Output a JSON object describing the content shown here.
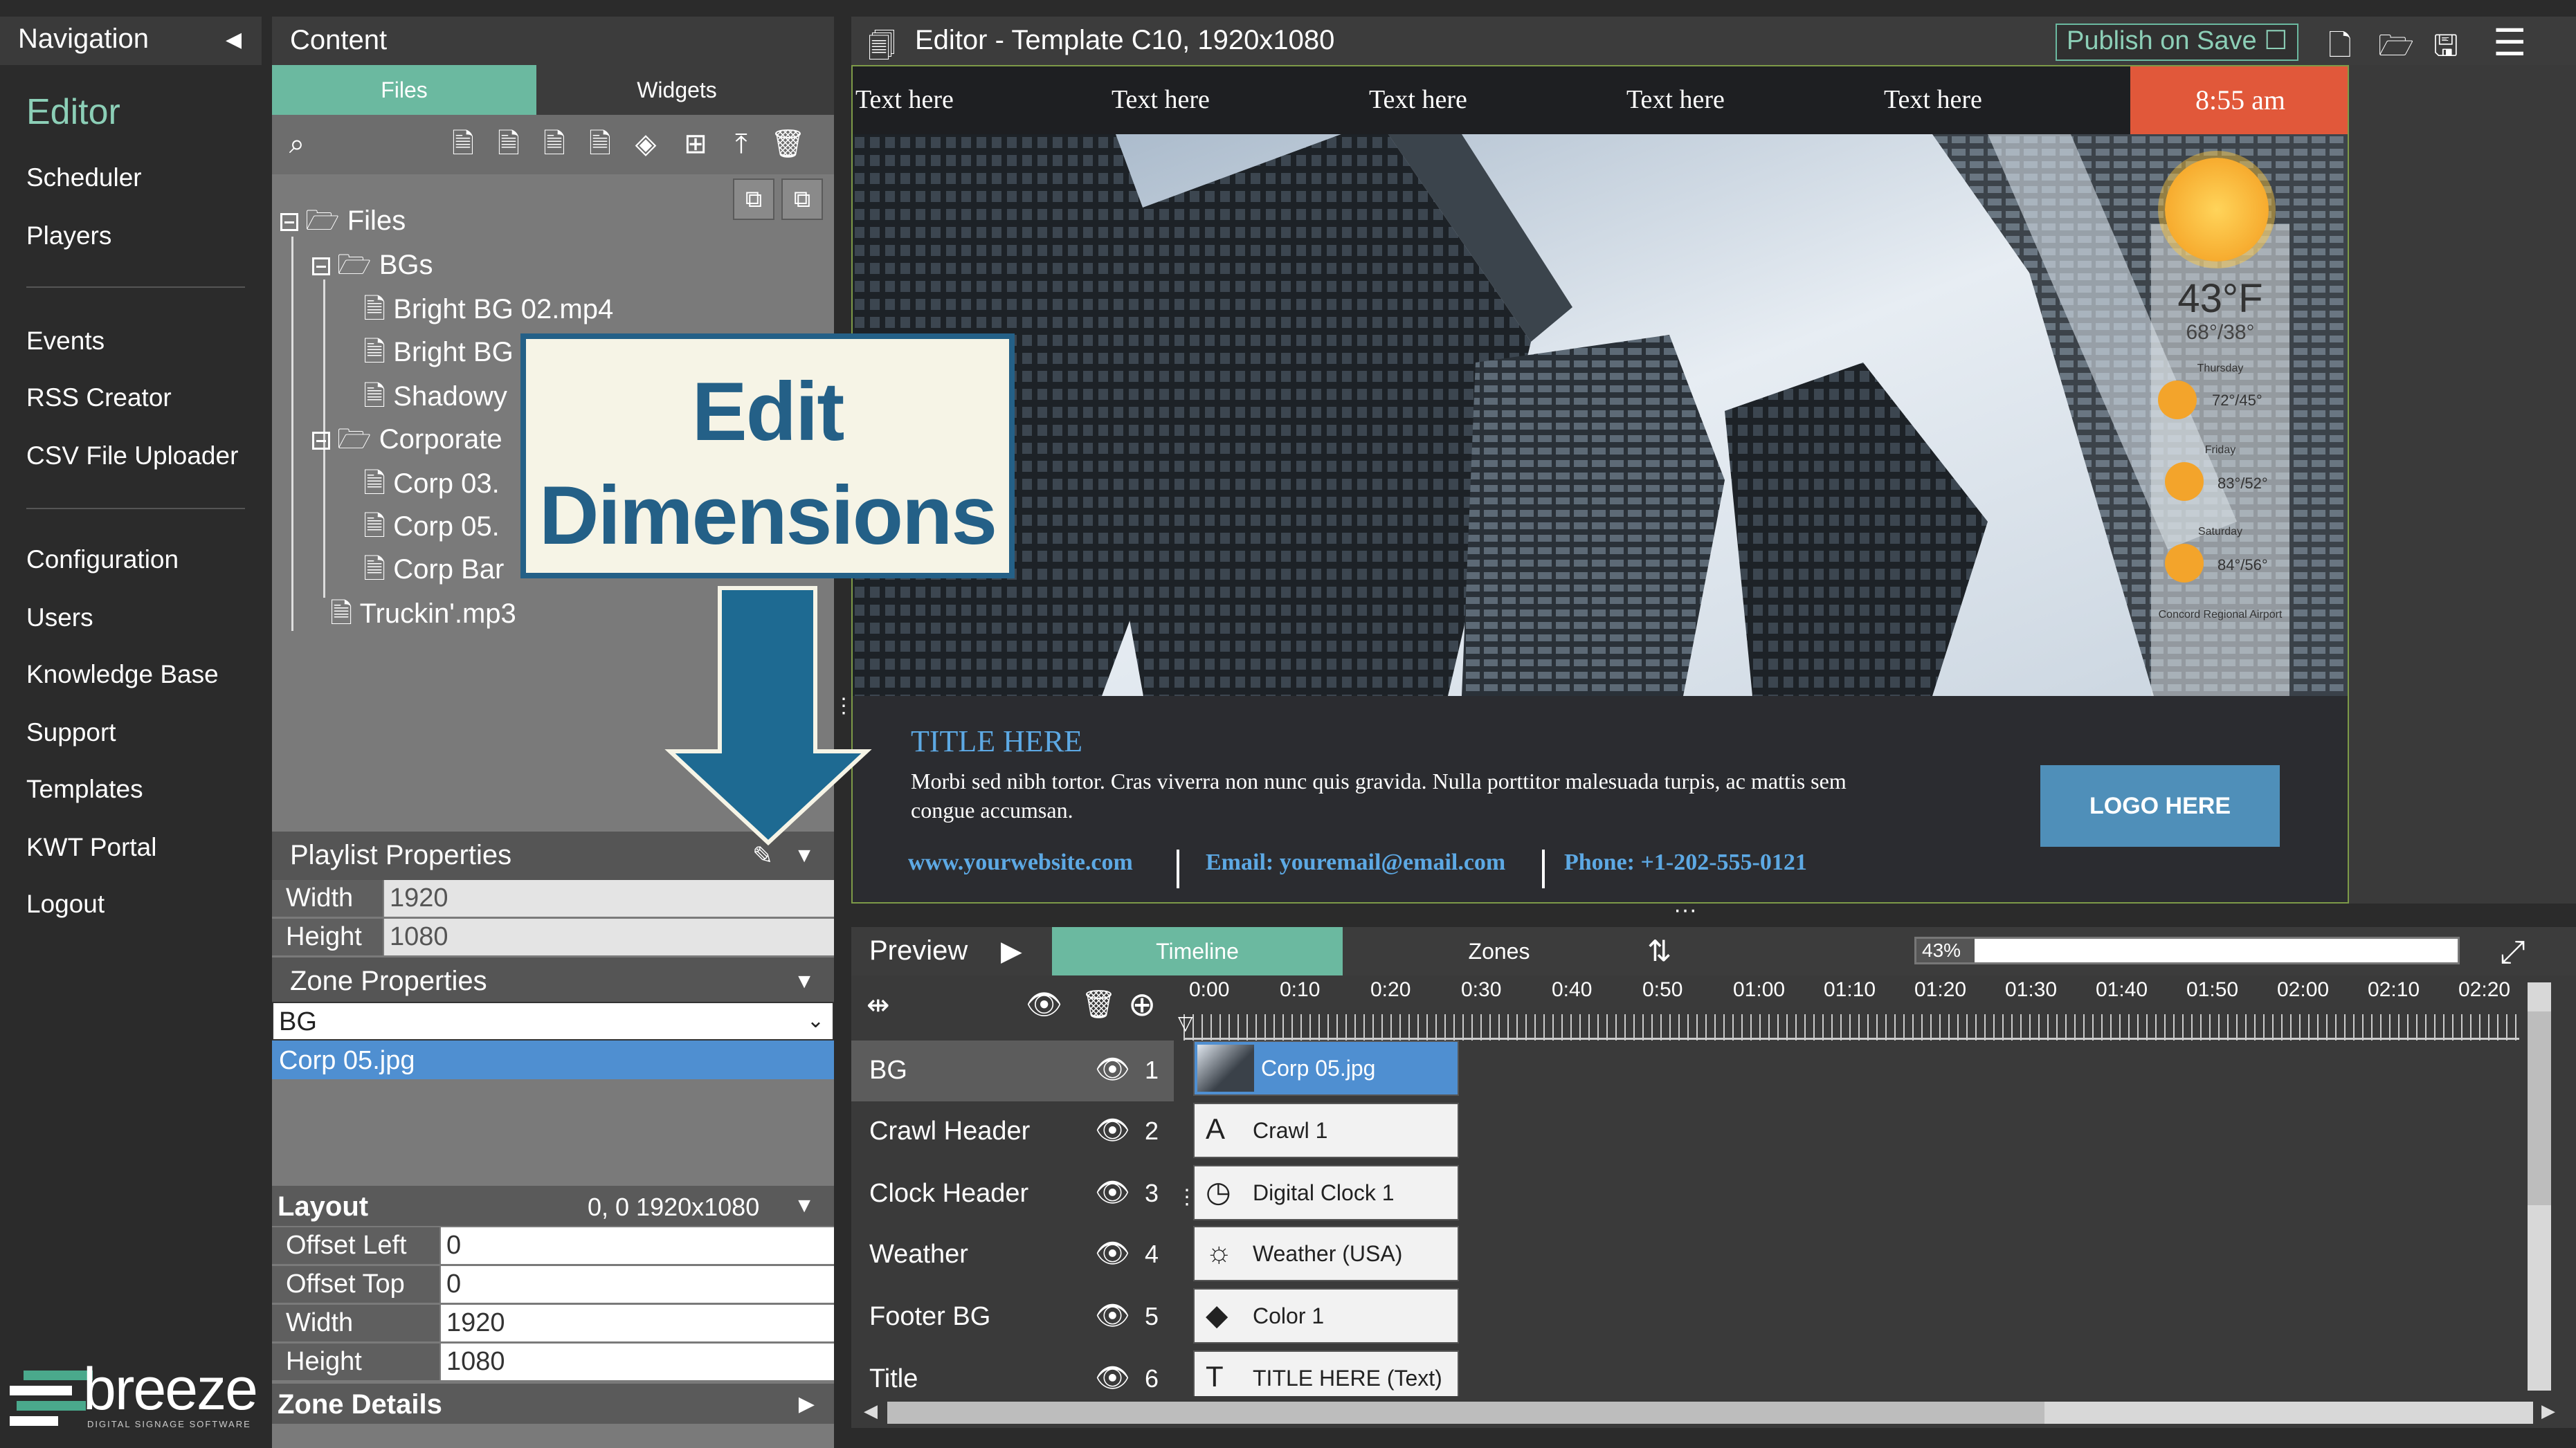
{
  "nav": {
    "title": "Navigation",
    "items": [
      "Editor",
      "Scheduler",
      "Players",
      "Events",
      "RSS Creator",
      "CSV File Uploader",
      "Configuration",
      "Users",
      "Knowledge Base",
      "Support",
      "Templates",
      "KWT Portal",
      "Logout"
    ],
    "brand": "breeze",
    "brand_tagline": "DIGITAL SIGNAGE SOFTWARE"
  },
  "content": {
    "title": "Content",
    "tabs": [
      "Files",
      "Widgets"
    ],
    "tree": {
      "root": "Files",
      "bgs_folder": "BGs",
      "bgs": [
        "Bright BG 02.mp4",
        "Bright BG 07.mp4",
        "Shadowy"
      ],
      "corporate_folder": "Corporate",
      "corporate": [
        "Corp 03.",
        "Corp 05.",
        "Corp Bar"
      ],
      "loose_file": "Truckin'.mp3"
    }
  },
  "playlist": {
    "title": "Playlist Properties",
    "width_label": "Width",
    "width_value": "1920",
    "height_label": "Height",
    "height_value": "1080"
  },
  "zone": {
    "title": "Zone Properties",
    "selected": "BG",
    "item": "Corp 05.jpg"
  },
  "layout": {
    "title": "Layout",
    "summary": "0, 0   1920x1080",
    "offset_left_label": "Offset Left",
    "offset_left": "0",
    "offset_top_label": "Offset Top",
    "offset_top": "0",
    "width_label": "Width",
    "width": "1920",
    "height_label": "Height",
    "height": "1080",
    "zone_details": "Zone Details"
  },
  "editor": {
    "title": "Editor - Template C10, 1920x1080",
    "publish": "Publish on Save"
  },
  "canvas": {
    "crawl": [
      "Text here",
      "Text here",
      "Text here",
      "Text here",
      "Text here"
    ],
    "clock": "8:55 am",
    "weather": {
      "temp": "43°F",
      "hilo": "68°/38°",
      "days": [
        {
          "name": "Thursday",
          "temps": "72°/45°"
        },
        {
          "name": "Friday",
          "temps": "83°/52°"
        },
        {
          "name": "Saturday",
          "temps": "84°/56°"
        }
      ],
      "location": "Concord Regional Airport"
    },
    "footer": {
      "title": "TITLE HERE",
      "body": "Morbi sed nibh tortor. Cras viverra non nunc quis gravida. Nulla porttitor malesuada turpis, ac mattis sem congue accumsan.",
      "website": "www.yourwebsite.com",
      "email": "Email: youremail@email.com",
      "phone": "Phone: +1-202-555-0121",
      "logo": "LOGO HERE"
    }
  },
  "timeline": {
    "preview": "Preview",
    "tabs": [
      "Timeline",
      "Zones"
    ],
    "zoom_pct": "43%",
    "zoom_fraction": 0.43,
    "ticks": [
      "0:00",
      "0:10",
      "0:20",
      "0:30",
      "0:40",
      "0:50",
      "01:00",
      "01:10",
      "01:20",
      "01:30",
      "01:40",
      "01:50",
      "02:00",
      "02:10",
      "02:20"
    ],
    "rows": [
      {
        "zone": "BG",
        "num": "1",
        "clip": "Corp 05.jpg"
      },
      {
        "zone": "Crawl Header",
        "num": "2",
        "clip": "Crawl 1"
      },
      {
        "zone": "Clock Header",
        "num": "3",
        "clip": "Digital Clock 1"
      },
      {
        "zone": "Weather",
        "num": "4",
        "clip": "Weather (USA)"
      },
      {
        "zone": "Footer BG",
        "num": "5",
        "clip": "Color 1"
      },
      {
        "zone": "Title",
        "num": "6",
        "clip": "TITLE HERE (Text)"
      }
    ]
  },
  "callout": {
    "line1": "Edit",
    "line2": "Dimensions"
  },
  "colors": {
    "accent": "#6bb9a0",
    "selection": "#4f8fd1",
    "callout": "#246087",
    "clock_bg": "#e1583a"
  }
}
